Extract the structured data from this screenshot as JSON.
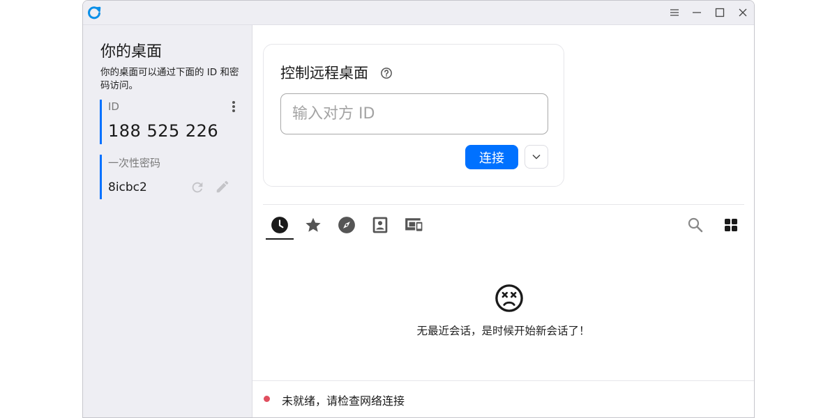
{
  "colors": {
    "accent": "#0071ff",
    "status_error": "#e04f5f"
  },
  "titlebar": {
    "logo_icon": "rustdesk-logo-icon",
    "buttons": [
      "menu-icon",
      "minimize-icon",
      "maximize-icon",
      "close-icon"
    ]
  },
  "sidebar": {
    "title": "你的桌面",
    "description": "你的桌面可以通过下面的 ID 和密码访问。",
    "id_label": "ID",
    "id_value": "188 525 226",
    "password_label": "一次性密码",
    "password_value": "8icbc2"
  },
  "connect_card": {
    "title": "控制远程桌面",
    "input_placeholder": "输入对方 ID",
    "connect_button": "连接"
  },
  "tabs": [
    {
      "icon": "recent-sessions-icon",
      "active": true
    },
    {
      "icon": "favorites-star-icon",
      "active": false
    },
    {
      "icon": "discovered-compass-icon",
      "active": false
    },
    {
      "icon": "address-book-icon",
      "active": false
    },
    {
      "icon": "group-devices-icon",
      "active": false
    }
  ],
  "empty_state": {
    "icon": "sad-face-icon",
    "message": "无最近会话，是时候开始新会话了！"
  },
  "status": {
    "text": "未就绪，请检查网络连接"
  }
}
